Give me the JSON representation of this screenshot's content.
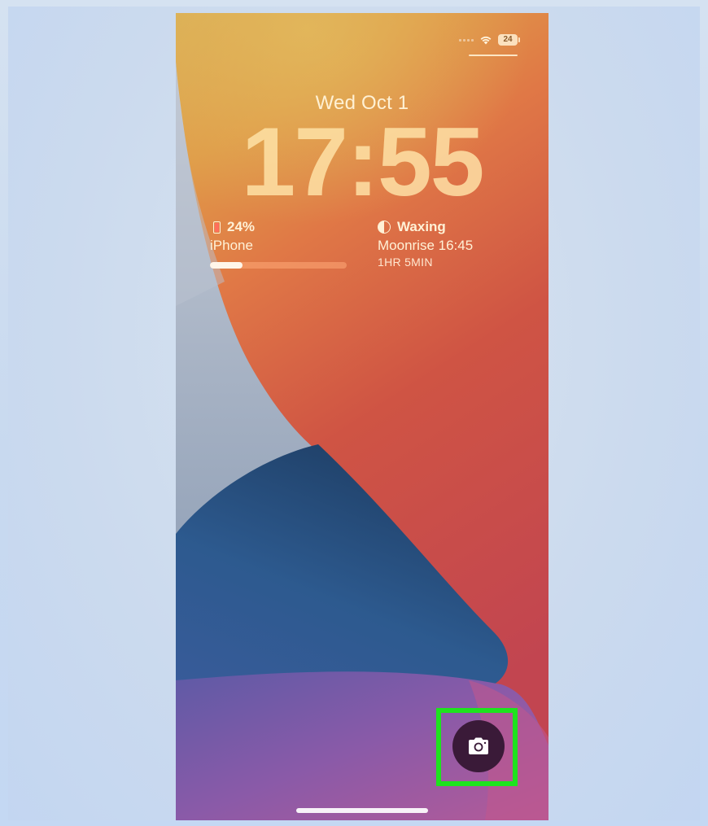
{
  "status_bar": {
    "battery_level": "24",
    "wifi_icon": "wifi-icon",
    "signal_icon": "cellular-signal-icon"
  },
  "lock_screen": {
    "date": "Wed Oct 1",
    "time": "17:55"
  },
  "widgets": {
    "battery": {
      "icon": "iphone-battery-icon",
      "percent_label": "24%",
      "device": "iPhone",
      "level": 0.24
    },
    "moon": {
      "icon": "moon-phase-icon",
      "phase": "Waxing",
      "moonrise": "Moonrise 16:45",
      "countdown": "1HR 5MIN"
    }
  },
  "camera_shortcut": {
    "icon": "camera-icon",
    "highlight_color": "#1ee31e"
  },
  "colors": {
    "wallpaper_orange": "#e3a046",
    "wallpaper_red": "#c84a42",
    "wallpaper_blue": "#2f5b8c",
    "wallpaper_purple": "#8a5aa8",
    "highlight": "#1ee31e"
  }
}
